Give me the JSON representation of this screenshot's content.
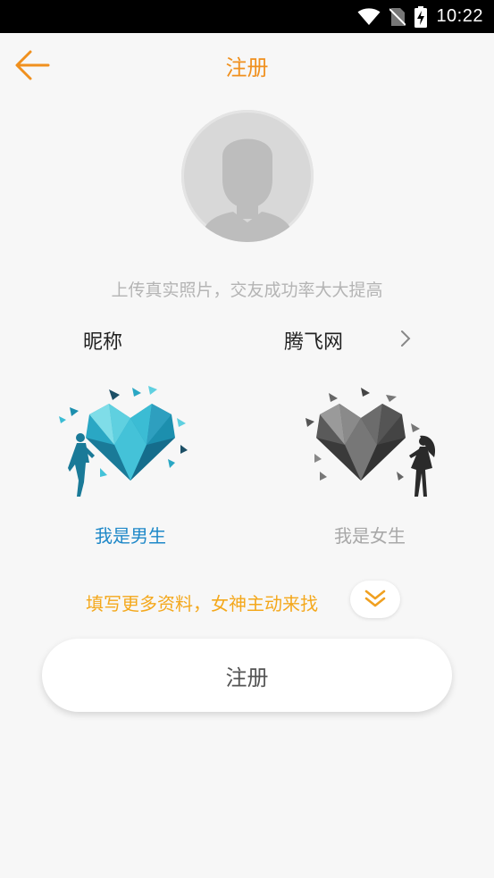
{
  "status_bar": {
    "time": "10:22",
    "icons": [
      "wifi-icon",
      "no-sim-icon",
      "battery-charging-icon"
    ]
  },
  "header": {
    "back_icon": "arrow-left-icon",
    "title": "注册"
  },
  "avatar": {
    "icon": "default-avatar-silhouette",
    "hint": "上传真实照片，交友成功率大大提高"
  },
  "nickname": {
    "label": "昵称",
    "value": "腾飞网",
    "icon": "chevron-right-icon"
  },
  "gender": {
    "selected": "male",
    "options": [
      {
        "id": "male",
        "label": "我是男生",
        "color": "#1e88c8"
      },
      {
        "id": "female",
        "label": "我是女生",
        "color": "#a8a8a8"
      }
    ]
  },
  "more_info": {
    "text": "填写更多资料，女神主动来找",
    "icon": "double-chevron-down-icon"
  },
  "register_button": {
    "label": "注册"
  },
  "colors": {
    "accent": "#f0901e",
    "hint_yellow": "#f4a81c",
    "male_blue": "#1e88c8",
    "background": "#f7f7f7"
  }
}
